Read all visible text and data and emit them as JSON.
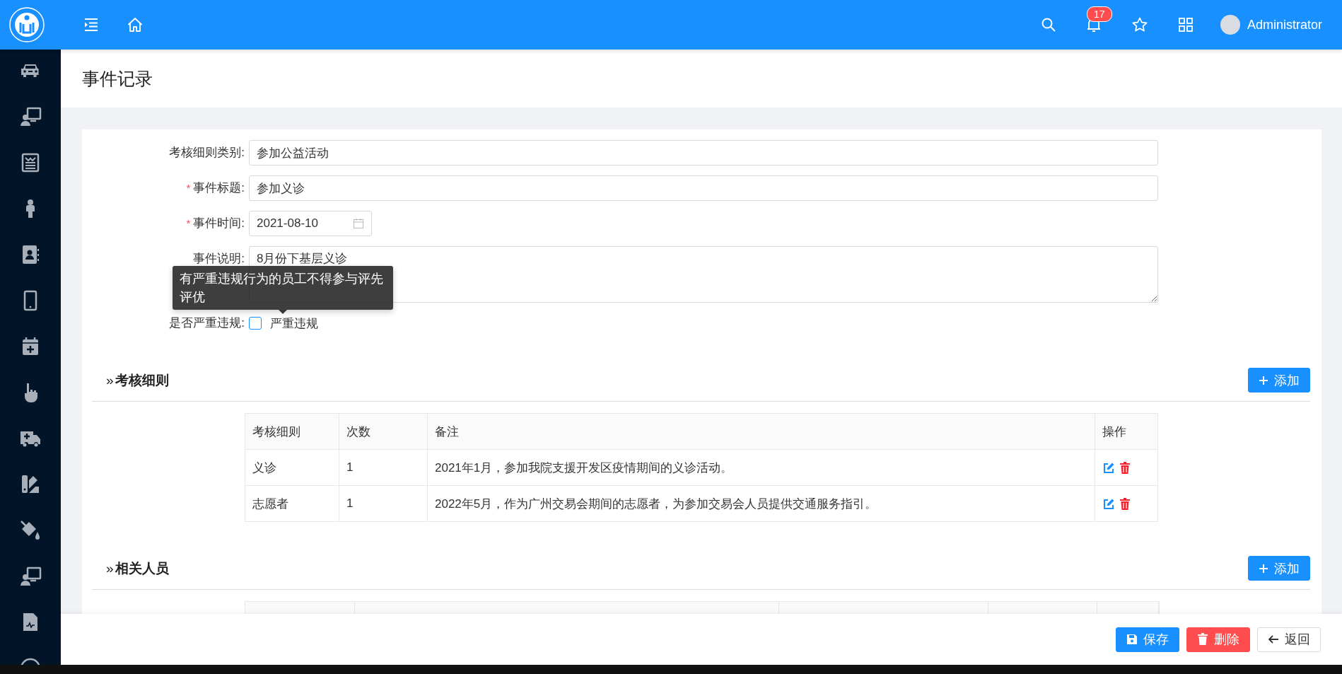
{
  "top_bar": {
    "notification_count": "17",
    "user_name": "Administrator"
  },
  "page_title": "事件记录",
  "form": {
    "required_mark": "*",
    "fields": [
      {
        "kind": "text",
        "label": "考核细则类别:",
        "required": false,
        "value": "参加公益活动"
      },
      {
        "kind": "text",
        "label": "事件标题:",
        "required": true,
        "value": "参加义诊"
      },
      {
        "kind": "date",
        "label": "事件时间:",
        "required": true,
        "value": "2021-08-10"
      },
      {
        "kind": "textarea",
        "label": "事件说明:",
        "required": false,
        "value": "8月份下基层义诊"
      },
      {
        "kind": "checkbox",
        "label": "是否严重违规:",
        "required": false,
        "option": "严重违规",
        "checked": false
      }
    ]
  },
  "tooltip": {
    "text": "有严重违规行为的员工不得参与评先评优"
  },
  "sections": [
    {
      "marker": "»",
      "title": "考核细则",
      "add_button": "添加",
      "table": {
        "columns": [
          "考核细则",
          "次数",
          "备注",
          "操作"
        ],
        "rows": [
          {
            "cells": [
              "义诊",
              "1",
              "2021年1月，参加我院支援开发区疫情期间的义诊活动。"
            ]
          },
          {
            "cells": [
              "志愿者",
              "1",
              "2022年5月，作为广州交易会期间的志愿者，为参加交易会人员提供交通服务指引。"
            ]
          }
        ]
      }
    },
    {
      "marker": "»",
      "title": "相关人员",
      "add_button": "添加"
    }
  ],
  "footer_buttons": [
    {
      "kind": "primary",
      "label": "保存"
    },
    {
      "kind": "danger",
      "label": "删除"
    },
    {
      "kind": "default",
      "label": "返回"
    }
  ]
}
